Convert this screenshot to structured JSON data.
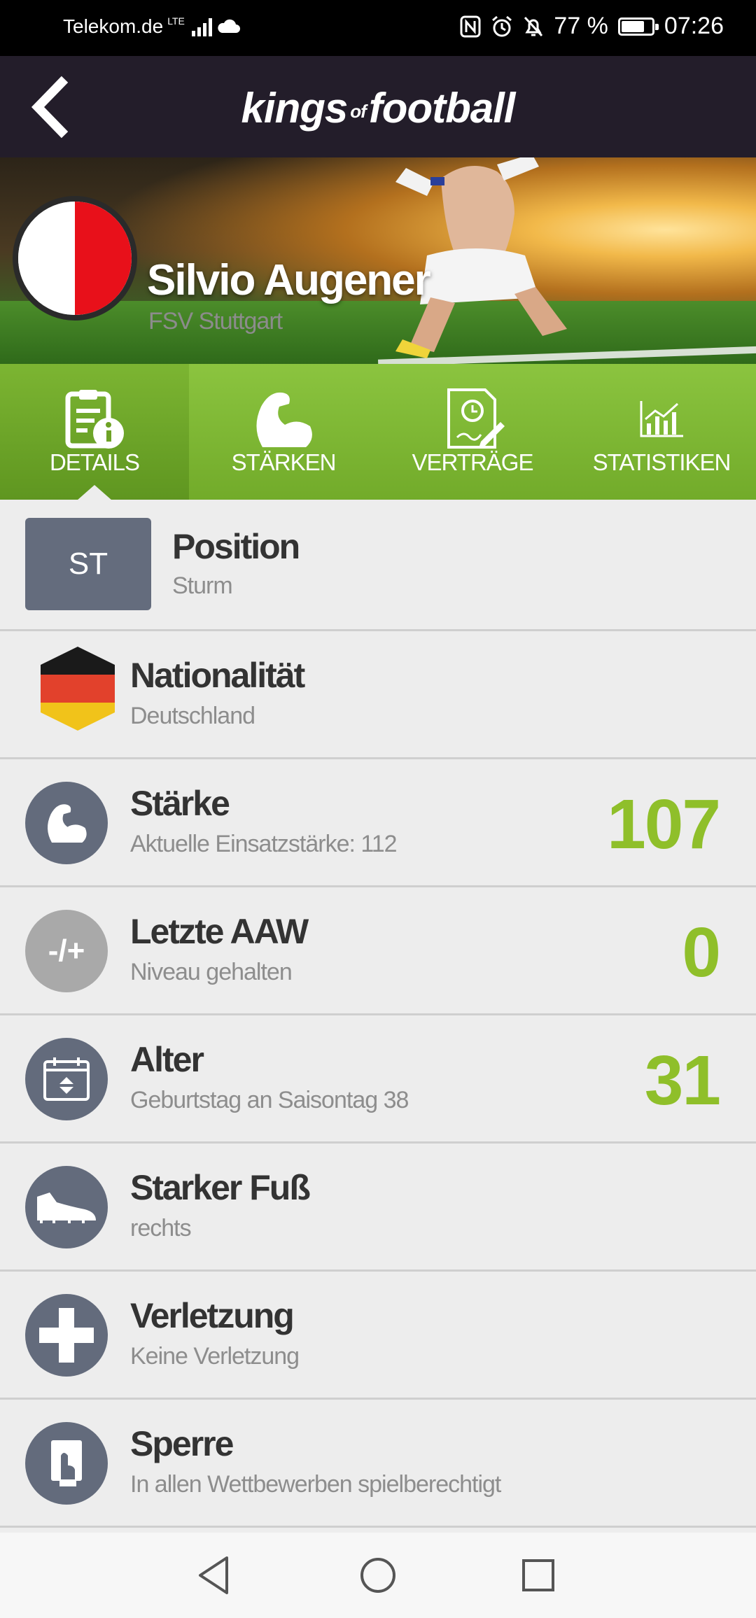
{
  "status_bar": {
    "carrier": "Telekom.de",
    "network": "LTE",
    "battery": "77 %",
    "battery_level": 0.77,
    "time": "07:26"
  },
  "header": {
    "brand_main1": "kings",
    "brand_of": "of",
    "brand_main2": "football"
  },
  "player": {
    "name": "Silvio Augener",
    "club": "FSV Stuttgart",
    "club_colors": [
      "#ffffff",
      "#e8101a"
    ]
  },
  "tabs": [
    {
      "label": "DETAILS",
      "icon": "clipboard-info-icon",
      "active": true
    },
    {
      "label": "STÄRKEN",
      "icon": "flexed-bicep-icon",
      "active": false
    },
    {
      "label": "VERTRÄGE",
      "icon": "contract-icon",
      "active": false
    },
    {
      "label": "STATISTIKEN",
      "icon": "bar-chart-icon",
      "active": false
    }
  ],
  "details": {
    "position": {
      "badge": "ST",
      "title": "Position",
      "sub": "Sturm"
    },
    "nationality": {
      "title": "Nationalität",
      "sub": "Deutschland",
      "icon": "germany-flag-icon"
    },
    "strength": {
      "title": "Stärke",
      "sub": "Aktuelle Einsatzstärke: 112",
      "value": "107",
      "icon": "bicep-icon"
    },
    "last_aaw": {
      "title": "Letzte AAW",
      "sub": "Niveau gehalten",
      "value": "0",
      "icon_text": "-/+"
    },
    "age": {
      "title": "Alter",
      "sub": "Geburtstag an Saisontag 38",
      "value": "31",
      "icon": "calendar-icon"
    },
    "foot": {
      "title": "Starker Fuß",
      "sub": "rechts",
      "icon": "football-boot-icon"
    },
    "injury": {
      "title": "Verletzung",
      "sub": "Keine Verletzung",
      "icon": "plus-icon"
    },
    "ban": {
      "title": "Sperre",
      "sub": "In allen Wettbewerben spielberechtigt",
      "icon": "red-card-icon"
    }
  },
  "colors": {
    "accent_green": "#8fbf2a",
    "header_dark": "#231d2a",
    "icon_slate": "#636b7c"
  }
}
